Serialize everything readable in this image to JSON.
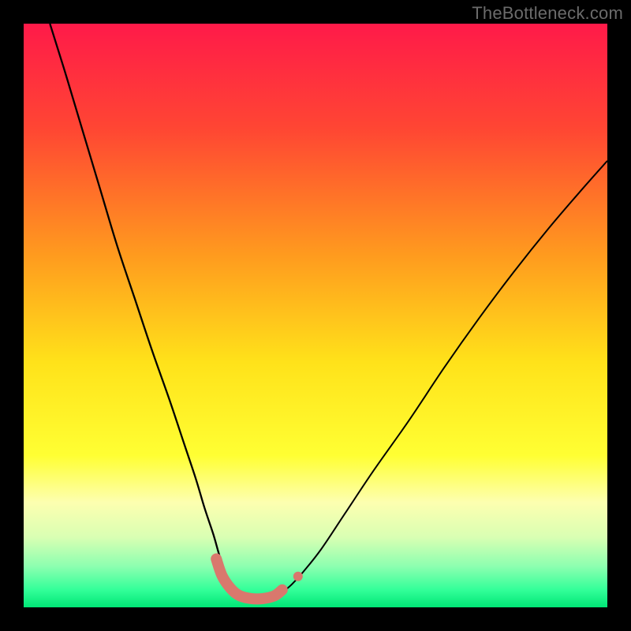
{
  "watermark": "TheBottleneck.com",
  "chart_data": {
    "type": "line",
    "title": "",
    "xlabel": "",
    "ylabel": "",
    "xlim": [
      0,
      100
    ],
    "ylim": [
      0,
      100
    ],
    "background": {
      "type": "vertical-gradient",
      "stops": [
        {
          "offset": 0.0,
          "color": "#ff1a49"
        },
        {
          "offset": 0.18,
          "color": "#ff4633"
        },
        {
          "offset": 0.4,
          "color": "#ff9c1e"
        },
        {
          "offset": 0.58,
          "color": "#ffe21a"
        },
        {
          "offset": 0.74,
          "color": "#ffff33"
        },
        {
          "offset": 0.82,
          "color": "#fdffb0"
        },
        {
          "offset": 0.88,
          "color": "#d9ffb3"
        },
        {
          "offset": 0.93,
          "color": "#8cffb0"
        },
        {
          "offset": 0.97,
          "color": "#33ff99"
        },
        {
          "offset": 1.0,
          "color": "#00e676"
        }
      ]
    },
    "series": [
      {
        "name": "left-curve",
        "stroke": "#000000",
        "stroke_width": 2.3,
        "points": [
          {
            "x": 4.5,
            "y": 100.0
          },
          {
            "x": 7.0,
            "y": 92.0
          },
          {
            "x": 10.0,
            "y": 82.0
          },
          {
            "x": 13.0,
            "y": 72.0
          },
          {
            "x": 16.0,
            "y": 62.0
          },
          {
            "x": 19.0,
            "y": 53.0
          },
          {
            "x": 22.0,
            "y": 44.0
          },
          {
            "x": 25.0,
            "y": 35.5
          },
          {
            "x": 27.5,
            "y": 28.0
          },
          {
            "x": 29.5,
            "y": 22.0
          },
          {
            "x": 31.0,
            "y": 17.0
          },
          {
            "x": 32.5,
            "y": 12.5
          },
          {
            "x": 33.5,
            "y": 9.0
          },
          {
            "x": 34.5,
            "y": 6.0
          },
          {
            "x": 35.5,
            "y": 4.0
          },
          {
            "x": 36.5,
            "y": 2.7
          },
          {
            "x": 38.0,
            "y": 1.9
          }
        ]
      },
      {
        "name": "right-curve",
        "stroke": "#000000",
        "stroke_width": 2.0,
        "points": [
          {
            "x": 44.5,
            "y": 2.7
          },
          {
            "x": 46.0,
            "y": 4.0
          },
          {
            "x": 48.0,
            "y": 6.2
          },
          {
            "x": 51.0,
            "y": 10.0
          },
          {
            "x": 55.0,
            "y": 16.0
          },
          {
            "x": 60.0,
            "y": 23.5
          },
          {
            "x": 66.0,
            "y": 32.0
          },
          {
            "x": 72.0,
            "y": 41.0
          },
          {
            "x": 78.0,
            "y": 49.5
          },
          {
            "x": 84.0,
            "y": 57.5
          },
          {
            "x": 90.0,
            "y": 65.0
          },
          {
            "x": 96.0,
            "y": 72.0
          },
          {
            "x": 100.0,
            "y": 76.5
          }
        ]
      },
      {
        "name": "bottleneck-band",
        "stroke": "#d9786d",
        "stroke_width": 14,
        "linecap": "round",
        "points": [
          {
            "x": 33.0,
            "y": 8.3
          },
          {
            "x": 34.0,
            "y": 5.4
          },
          {
            "x": 35.5,
            "y": 3.2
          },
          {
            "x": 37.0,
            "y": 2.0
          },
          {
            "x": 39.0,
            "y": 1.5
          },
          {
            "x": 41.0,
            "y": 1.5
          },
          {
            "x": 43.0,
            "y": 2.0
          },
          {
            "x": 44.3,
            "y": 3.0
          }
        ]
      },
      {
        "name": "right-dot",
        "type": "marker",
        "fill": "#d9786d",
        "r": 6,
        "points": [
          {
            "x": 47.0,
            "y": 5.3
          }
        ]
      }
    ]
  }
}
